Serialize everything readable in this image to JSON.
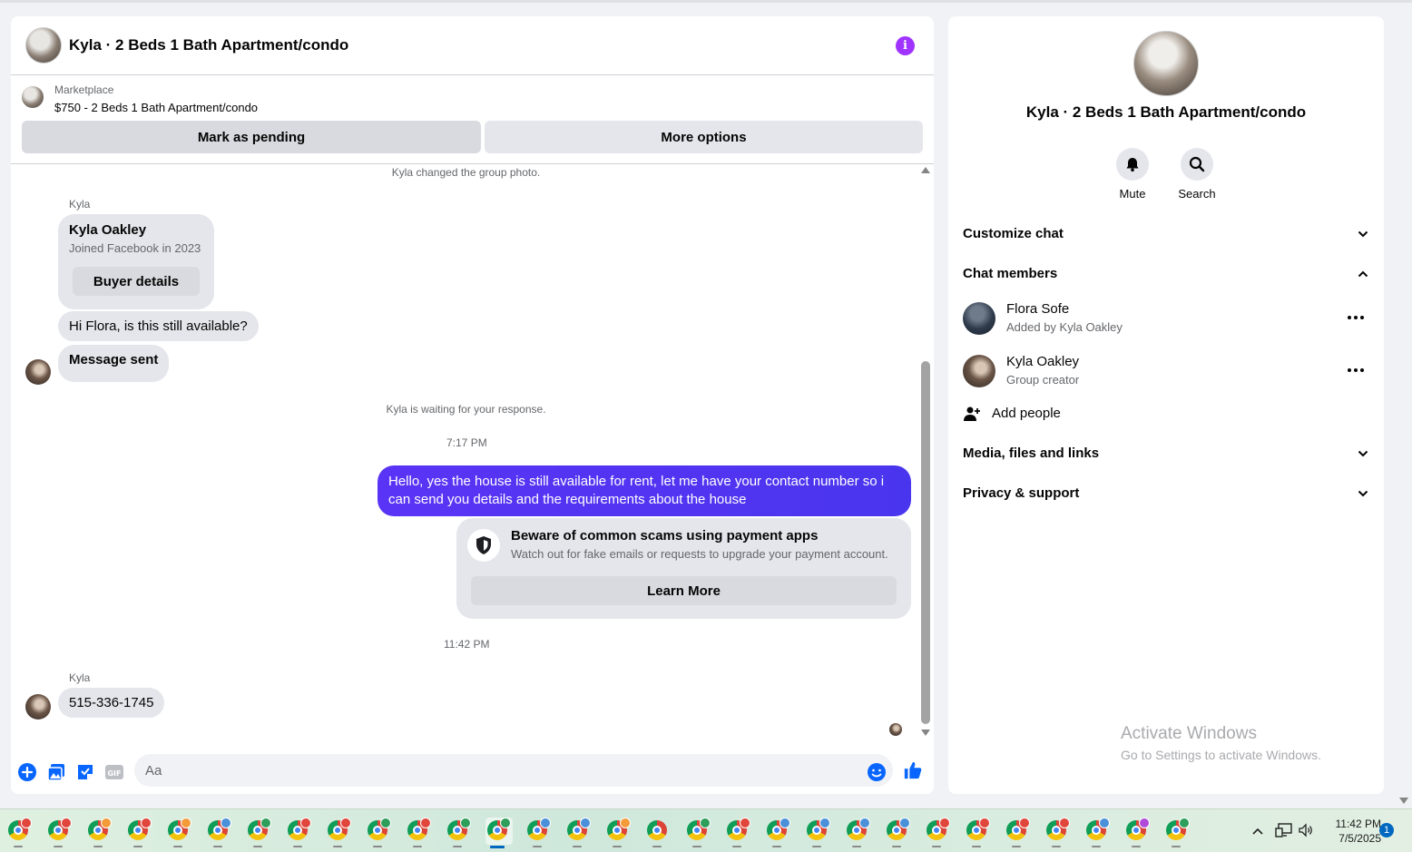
{
  "chat": {
    "title": "Kyla · 2 Beds 1 Bath Apartment/condo",
    "marketplace_label": "Marketplace",
    "listing_title": "$750 - 2 Beds 1 Bath Apartment/condo",
    "mark_pending_label": "Mark as pending",
    "more_options_label": "More options"
  },
  "messages": {
    "sys_group_photo": "Kyla changed the group photo.",
    "sender_1": "Kyla",
    "profile_card": {
      "name": "Kyla Oakley",
      "joined": "Joined Facebook in 2023",
      "button": "Buyer details"
    },
    "incoming_1": "Hi Flora, is this still available?",
    "incoming_2": "Message sent",
    "sys_waiting": "Kyla is waiting for your response.",
    "time_1": "7:17 PM",
    "outgoing_1": "Hello, yes the house is still available for rent, let me have your contact number so i can send you details and the requirements about the house",
    "scam_card": {
      "title": "Beware of common scams using payment apps",
      "subtitle": "Watch out for fake emails or requests to upgrade your payment account.",
      "button": "Learn More"
    },
    "time_2": "11:42 PM",
    "sender_2": "Kyla",
    "incoming_3": "515-336-1745"
  },
  "composer": {
    "placeholder": "Aa",
    "icons": [
      "plus-icon",
      "photo-icon",
      "sticker-icon",
      "gif-icon",
      "emoji-icon",
      "like-icon"
    ],
    "gif_label": "GIF"
  },
  "sidebar": {
    "title": "Kyla · 2 Beds 1 Bath Apartment/condo",
    "mute_label": "Mute",
    "search_label": "Search",
    "customize_label": "Customize chat",
    "members_label": "Chat members",
    "members": [
      {
        "name": "Flora Sofe",
        "sub": "Added by Kyla Oakley"
      },
      {
        "name": "Kyla Oakley",
        "sub": "Group creator"
      }
    ],
    "add_people_label": "Add people",
    "media_label": "Media, files and links",
    "privacy_label": "Privacy & support"
  },
  "watermark": {
    "line1": "Activate Windows",
    "line2": "Go to Settings to activate Windows."
  },
  "taskbar": {
    "time": "11:42 PM",
    "date": "7/5/2025",
    "notification_count": "1",
    "badge_colors": [
      "#e0463c",
      "#e0463c",
      "#f29b38",
      "#e0463c",
      "#f29b38",
      "#4a90d9",
      "#2e9e5b",
      "#e0463c",
      "#e0463c",
      "#2e9e5b",
      "#e0463c",
      "#2e9e5b",
      "#2e9e5b",
      "#4a90d9",
      "#4a90d9",
      "#f29b38",
      "",
      "#2e9e5b",
      "#e0463c",
      "#4a90d9",
      "#4a90d9",
      "#4a90d9",
      "#4a90d9",
      "#e0463c",
      "#e0463c",
      "#e0463c",
      "#e0463c",
      "#4a90d9",
      "#b04ad9",
      "#2e9e5b"
    ]
  },
  "colors": {
    "accent": "#a033ff",
    "outgoing_bubble": "#5a34f6",
    "like": "#0866ff"
  }
}
